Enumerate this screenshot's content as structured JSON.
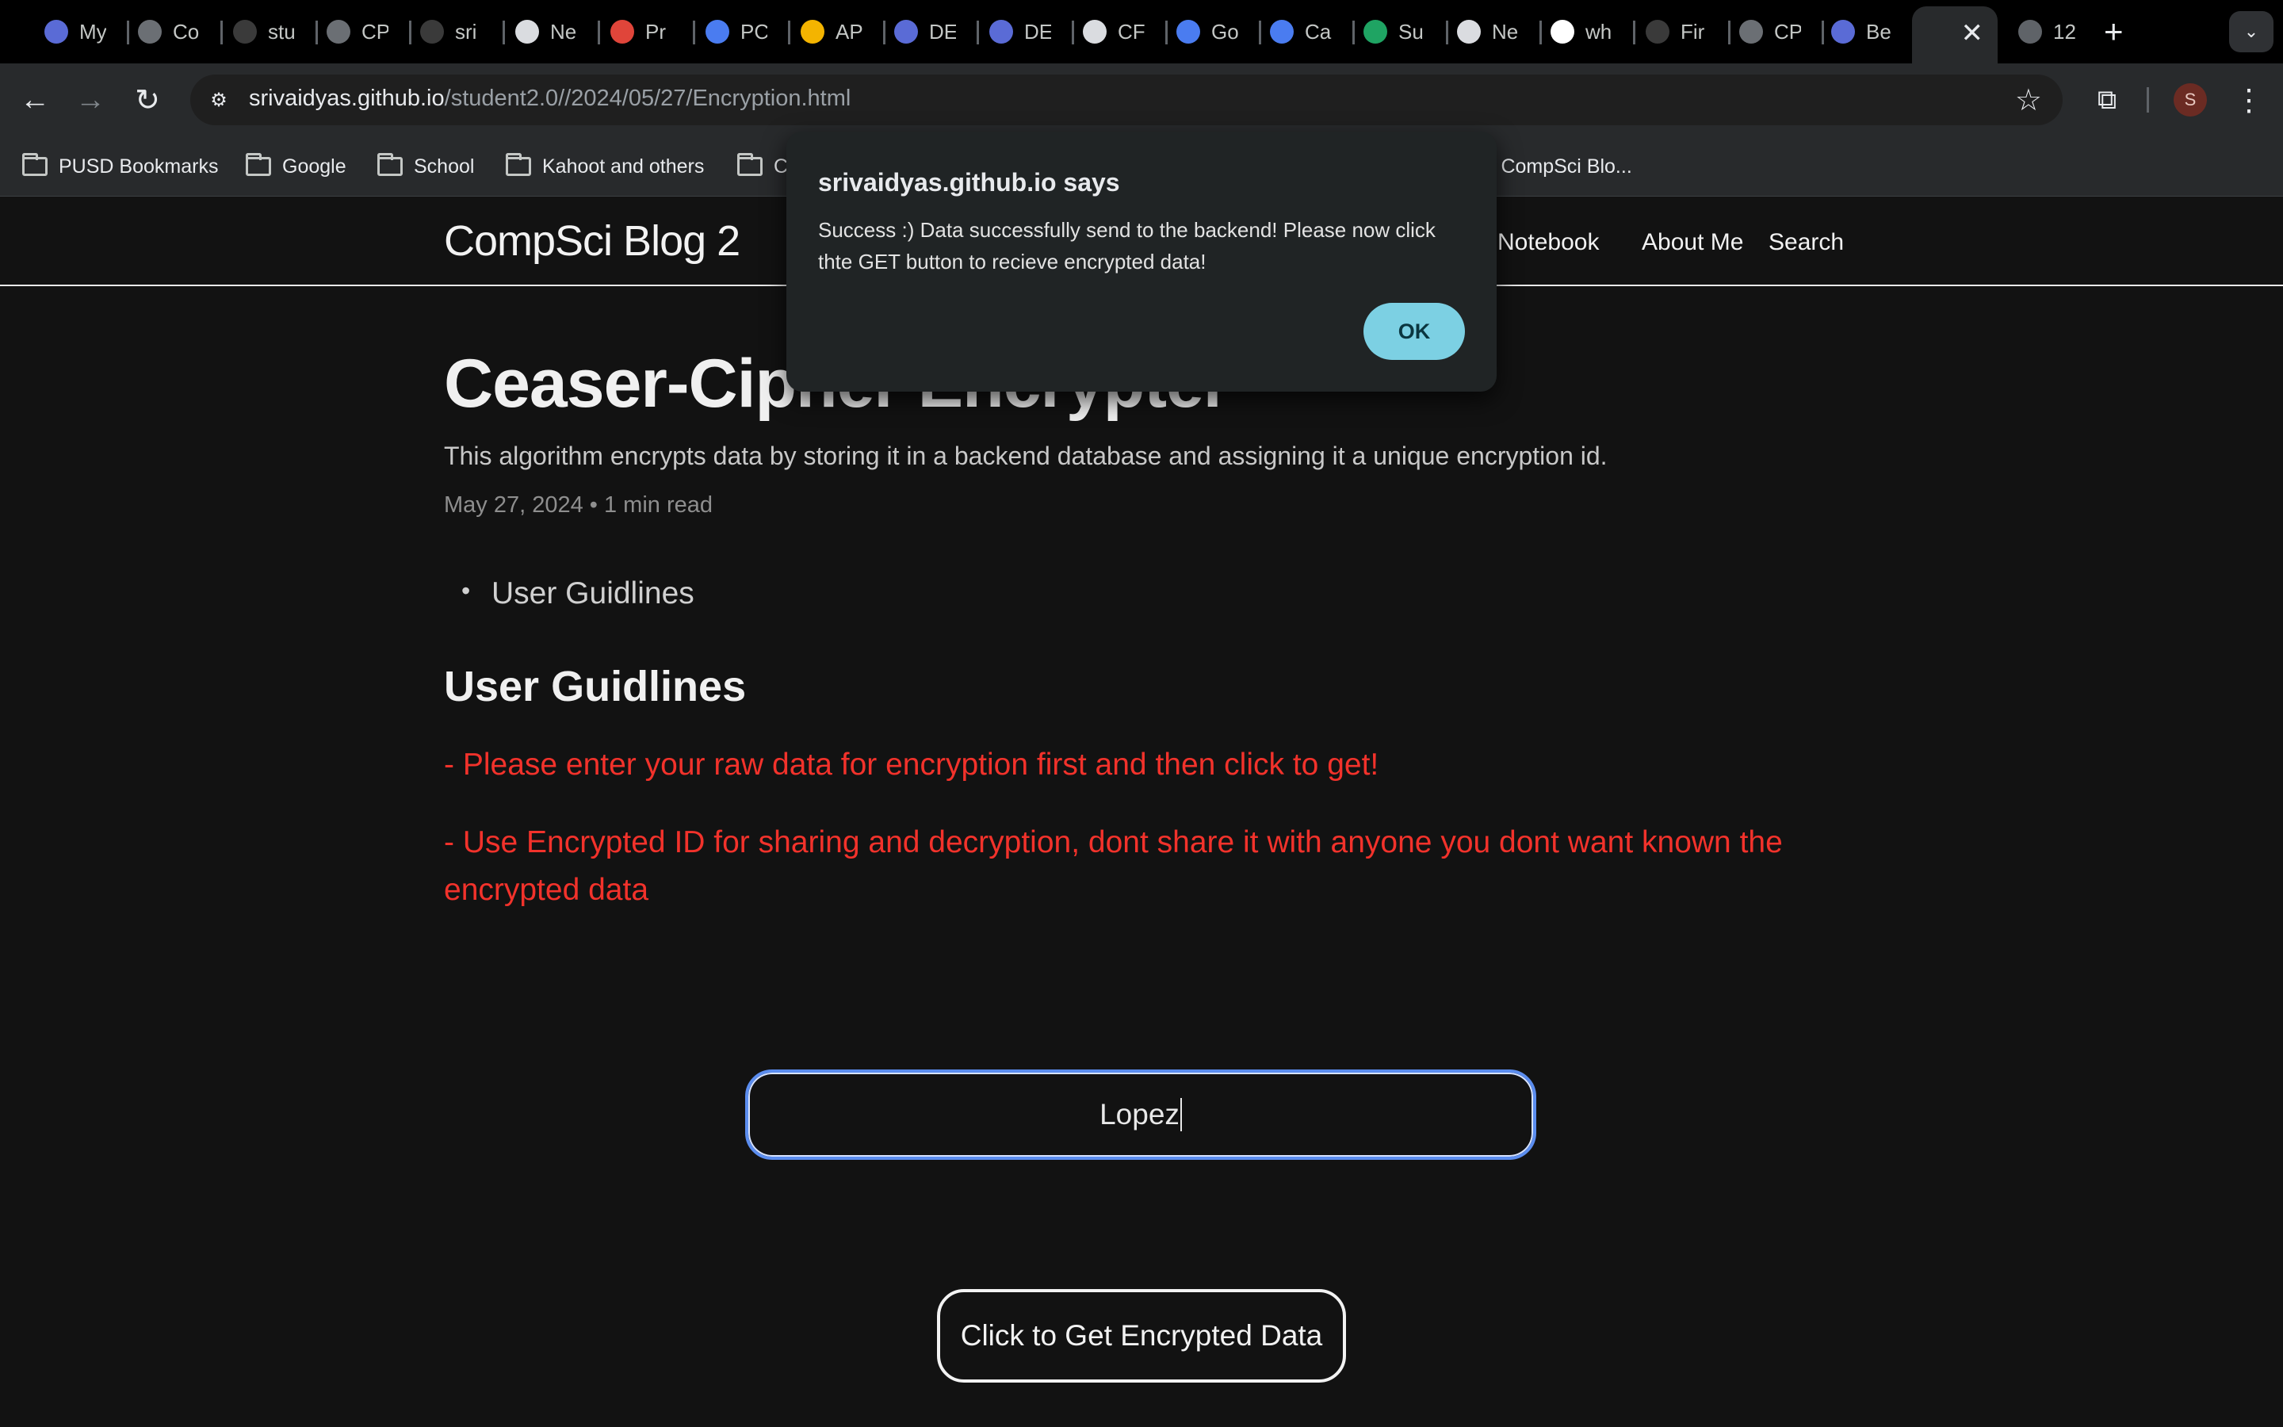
{
  "browser": {
    "tabs": [
      {
        "label": "My",
        "icon": "compass-icon",
        "color": "#5a6bd6"
      },
      {
        "label": "Co",
        "icon": "search-icon",
        "color": "#6b6f74"
      },
      {
        "label": "stu",
        "icon": "github-icon",
        "color": "#3a3a3a"
      },
      {
        "label": "CP",
        "icon": "search-icon",
        "color": "#6b6f74"
      },
      {
        "label": "sri",
        "icon": "github-icon",
        "color": "#3a3a3a"
      },
      {
        "label": "Ne",
        "icon": "chrome-icon",
        "color": "#dadce0"
      },
      {
        "label": "Pr",
        "icon": "sun-icon",
        "color": "#e0453a"
      },
      {
        "label": "PC",
        "icon": "docs-icon",
        "color": "#4a7cf0"
      },
      {
        "label": "AP",
        "icon": "slides-icon",
        "color": "#f4b400"
      },
      {
        "label": "DE",
        "icon": "compass-icon",
        "color": "#5a6bd6"
      },
      {
        "label": "DE",
        "icon": "compass-icon",
        "color": "#5a6bd6"
      },
      {
        "label": "CF",
        "icon": "cpm-icon",
        "color": "#dadce0"
      },
      {
        "label": "Go",
        "icon": "docs-icon",
        "color": "#4a7cf0"
      },
      {
        "label": "Ca",
        "icon": "docs-icon",
        "color": "#4a7cf0"
      },
      {
        "label": "Su",
        "icon": "drive-icon",
        "color": "#1fa463"
      },
      {
        "label": "Ne",
        "icon": "chrome-icon",
        "color": "#dadce0"
      },
      {
        "label": "wh",
        "icon": "google-icon",
        "color": "#ffffff"
      },
      {
        "label": "Fir",
        "icon": "github-icon",
        "color": "#3a3a3a"
      },
      {
        "label": "CP",
        "icon": "search-icon",
        "color": "#6b6f74"
      },
      {
        "label": "Be",
        "icon": "compass-icon",
        "color": "#5a6bd6"
      }
    ],
    "last_tab_label": "12",
    "url_host": "srivaidyas.github.io",
    "url_path": "/student2.0//2024/05/27/Encryption.html",
    "profile_initial": "S",
    "bookmarks": [
      "PUSD Bookmarks",
      "Google",
      "School",
      "Kahoot and others",
      "C",
      "| CompSci Blo..."
    ]
  },
  "site": {
    "title": "CompSci Blog 2",
    "nav": [
      "b Notebook",
      "About Me",
      "Search"
    ]
  },
  "post": {
    "title": "Ceaser-Cipher Encrypter",
    "description": "This algorithm encrypts data by storing it in a backend database and assigning it a unique encryption id.",
    "meta": "May 27, 2024 • 1 min read",
    "toc": [
      "User Guidlines"
    ],
    "section_heading": "User Guidlines",
    "guideline_1": "- Please enter your raw data for encryption first and then click to get!",
    "guideline_2": "- Use Encrypted ID for sharing and decryption, dont share it with anyone you dont want known the encrypted data"
  },
  "form": {
    "input_value": "Lopez",
    "get_button_label": "Click to Get Encrypted Data"
  },
  "dialog": {
    "title": "srivaidyas.github.io says",
    "message": "Success :) Data successfully send to the backend! Please now click thte GET button to recieve encrypted data!",
    "ok_label": "OK"
  },
  "colors": {
    "accent_red": "#f2322b",
    "dialog_button": "#7cd0e3",
    "input_focus": "#5b8def"
  }
}
